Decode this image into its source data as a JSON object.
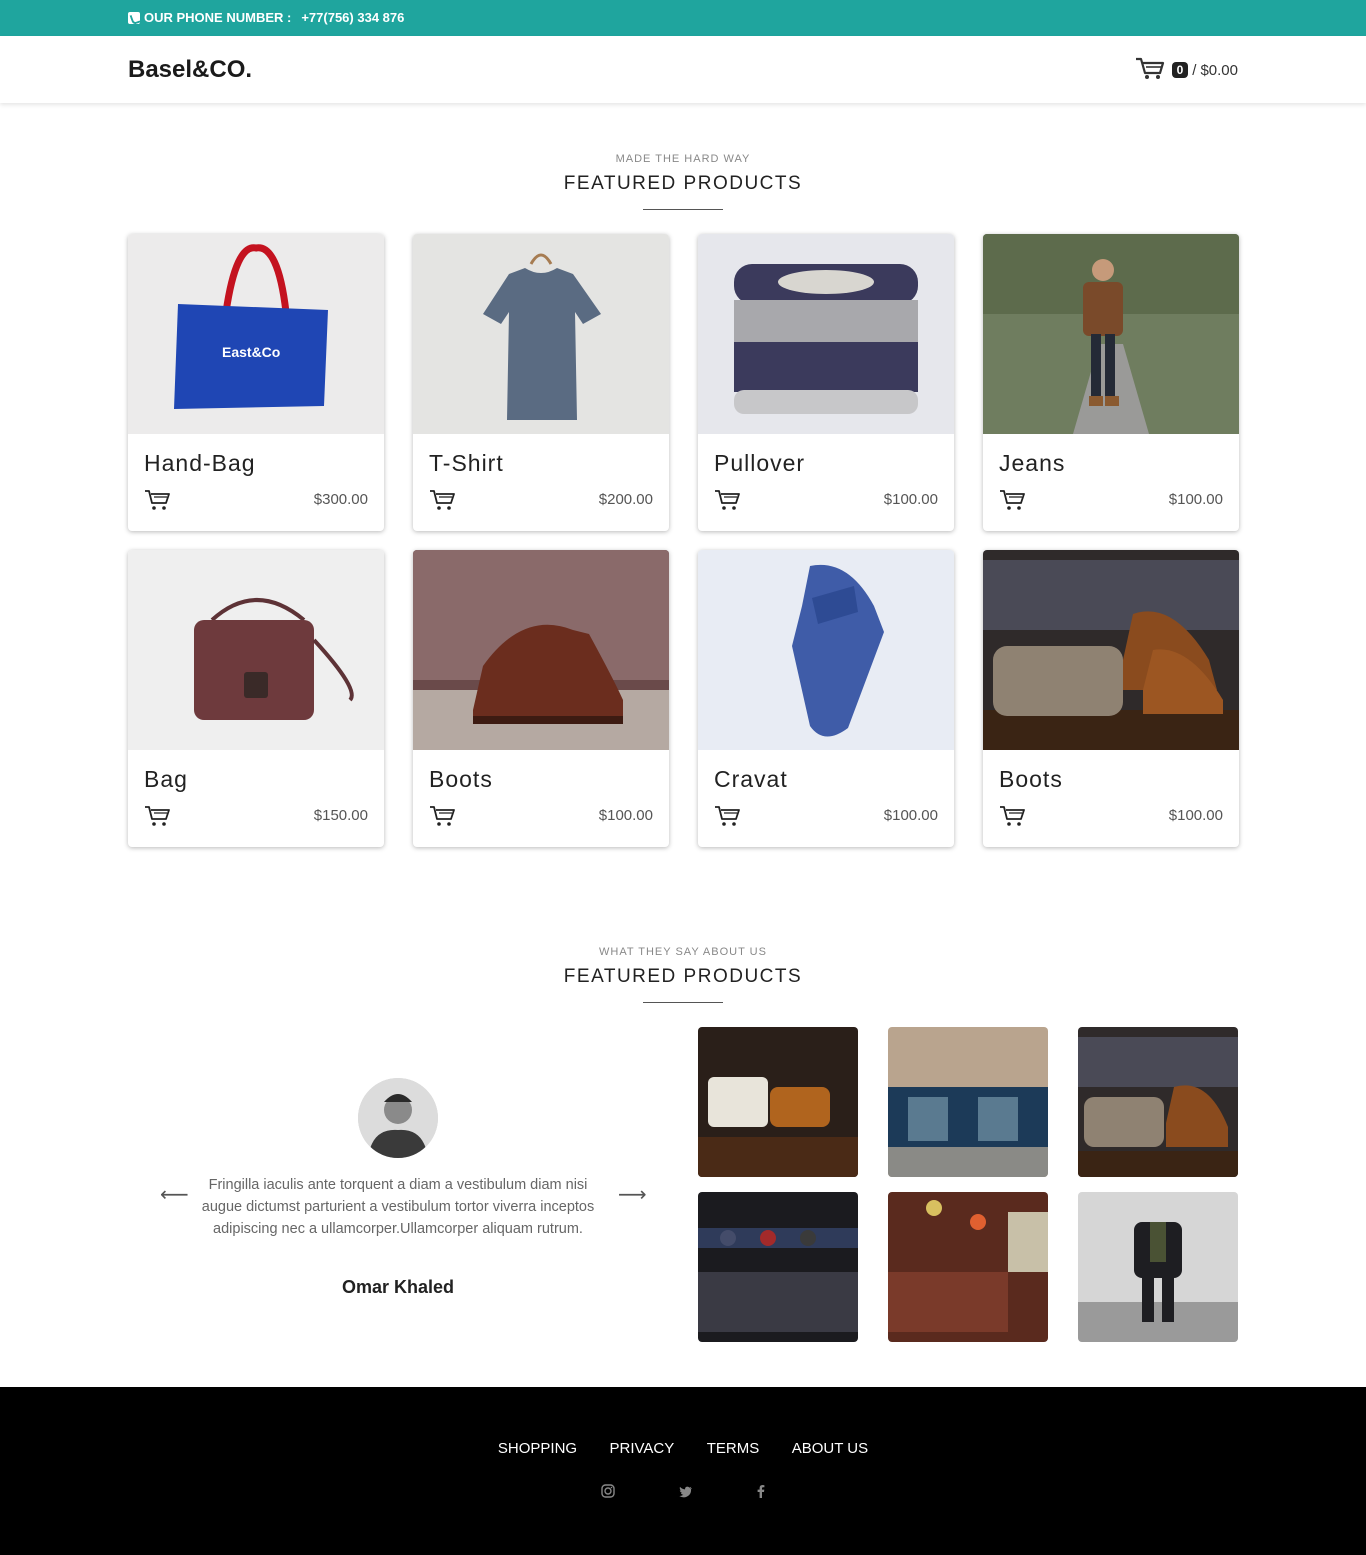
{
  "topbar": {
    "phone_label": "OUR PHONE NUMBER :",
    "phone_number": "+77(756) 334 876",
    "color": "#1fa59e"
  },
  "navbar": {
    "brand": "Basel&CO.",
    "cart_count": "0",
    "cart_separator": "/",
    "cart_total": "$0.00"
  },
  "featured": {
    "kicker": "MADE THE HARD WAY",
    "title": "FEATURED PRODUCTS",
    "products": [
      {
        "name": "Hand-Bag",
        "price": "$300.00",
        "image_icon": "handbag-photo"
      },
      {
        "name": "T-Shirt",
        "price": "$200.00",
        "image_icon": "tshirt-photo"
      },
      {
        "name": "Pullover",
        "price": "$100.00",
        "image_icon": "pullover-photo"
      },
      {
        "name": "Jeans",
        "price": "$100.00",
        "image_icon": "jeans-photo"
      },
      {
        "name": "Bag",
        "price": "$150.00",
        "image_icon": "bag-photo"
      },
      {
        "name": "Boots",
        "price": "$100.00",
        "image_icon": "boots-photo"
      },
      {
        "name": "Cravat",
        "price": "$100.00",
        "image_icon": "cravat-photo"
      },
      {
        "name": "Boots",
        "price": "$100.00",
        "image_icon": "boots-photo"
      }
    ]
  },
  "testimonials": {
    "kicker": "WHAT THEY SAY ABOUT US",
    "title": "FEATURED PRODUCTS",
    "quote": "Fringilla iaculis ante torquent a diam a vestibulum diam nisi augue dictumst parturient a vestibulum tortor viverra inceptos adipiscing nec a ullamcorper.Ullamcorper aliquam rutrum.",
    "author": "Omar Khaled"
  },
  "gallery": [
    "shoes-display-photo",
    "storefront-photo",
    "boots-sweaters-photo",
    "caps-rack-photo",
    "clothing-store-photo",
    "jacket-outfit-photo"
  ],
  "footer": {
    "links": [
      "SHOPPING",
      "PRIVACY",
      "TERMS",
      "ABOUT US"
    ],
    "socials": [
      "instagram-icon",
      "twitter-icon",
      "facebook-icon"
    ]
  }
}
